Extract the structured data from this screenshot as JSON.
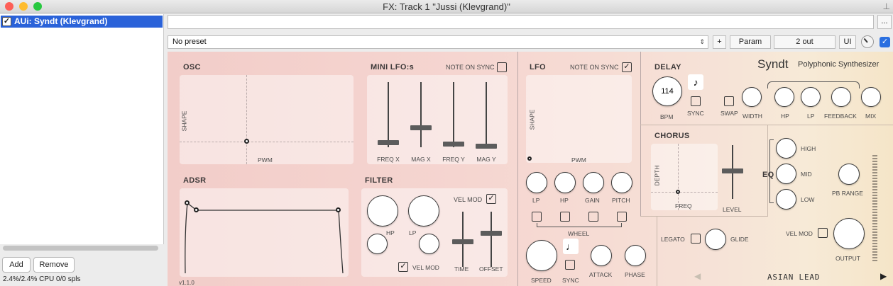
{
  "window": {
    "title": "FX: Track 1 \"Jussi (Klevgrand)\""
  },
  "fx_list": {
    "items": [
      {
        "label": "AUi: Syndt (Klevgrand)",
        "checked": true
      }
    ]
  },
  "buttons": {
    "add": "Add",
    "remove": "Remove",
    "more": "...",
    "plus": "+",
    "param": "Param",
    "io": "2 out",
    "ui": "UI"
  },
  "cpu": "2.4%/2.4% CPU 0/0 spls",
  "preset": {
    "value": "No preset"
  },
  "plugin": {
    "name": "Syndt",
    "tagline": "Polyphonic Synthesizer",
    "version": "v1.1.0",
    "osc": {
      "title": "OSC",
      "x_label": "PWM",
      "y_label": "SHAPE"
    },
    "mini_lfo": {
      "title": "MINI LFO:s",
      "note_on_sync": "NOTE ON SYNC",
      "sliders": [
        "FREQ X",
        "MAG X",
        "FREQ Y",
        "MAG Y"
      ]
    },
    "lfo": {
      "title": "LFO",
      "note_on_sync": "NOTE ON SYNC",
      "note_on_sync_checked": true,
      "x_label": "PWM",
      "y_label": "SHAPE",
      "knobs": [
        "LP",
        "HP",
        "GAIN",
        "PITCH"
      ],
      "wheel": "WHEEL",
      "speed": "SPEED",
      "sync": "SYNC",
      "attack": "ATTACK",
      "phase": "PHASE"
    },
    "adsr": {
      "title": "ADSR"
    },
    "filter": {
      "title": "FILTER",
      "vel_mod": "VEL MOD",
      "hp": "HP",
      "lp": "LP",
      "vel_mod_bottom": "VEL MOD",
      "time": "TIME",
      "offset": "OFFSET"
    },
    "delay": {
      "title": "DELAY",
      "bpm_value": "114",
      "bpm": "BPM",
      "sync": "SYNC",
      "swap": "SWAP",
      "knobs": [
        "WIDTH",
        "HP",
        "LP",
        "FEEDBACK",
        "MIX"
      ]
    },
    "chorus": {
      "title": "CHORUS",
      "x_label": "FREQ",
      "y_label": "DEPTH",
      "level": "LEVEL"
    },
    "eq": {
      "title": "EQ",
      "bands": [
        "HIGH",
        "MID",
        "LOW"
      ],
      "pb_range": "PB RANGE"
    },
    "legato": "LEGATO",
    "glide": "GLIDE",
    "vel_mod": "VEL MOD",
    "output": "OUTPUT",
    "preset_name": "ASIAN LEAD"
  },
  "colors": {
    "selection": "#2a62d9",
    "plugin_bg_left": "#f2cdc9",
    "plugin_bg_right": "#f5e5c8"
  }
}
